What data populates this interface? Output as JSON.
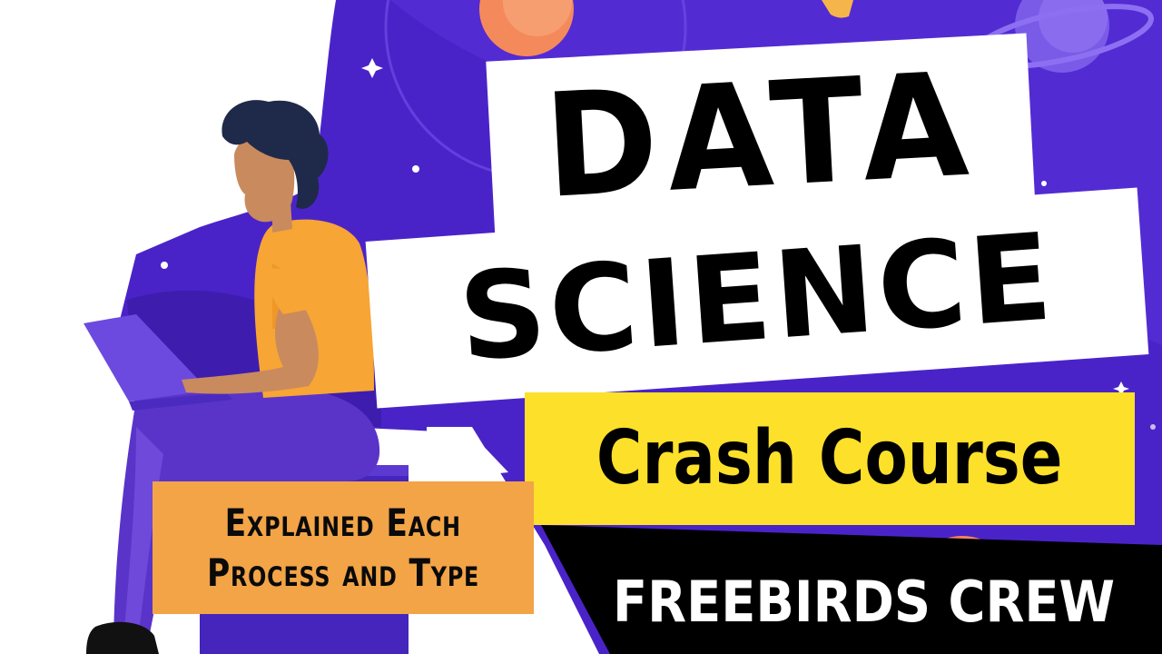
{
  "thumbnail": {
    "headline_line1": "DATA",
    "headline_line2": "SCIENCE",
    "subheadline": "Crash Course",
    "tagline_line1": "Explained Each",
    "tagline_line2": "Process and Type",
    "brand": "FREEBIRDS CREW"
  },
  "colors": {
    "space_background": "#4a23c8",
    "headline_box": "#ffffff",
    "subheadline_box": "#fde02a",
    "tagline_box": "#f2a447",
    "brand_banner": "#000000",
    "shirt": "#f7a534",
    "pants": "#5a34c9"
  }
}
